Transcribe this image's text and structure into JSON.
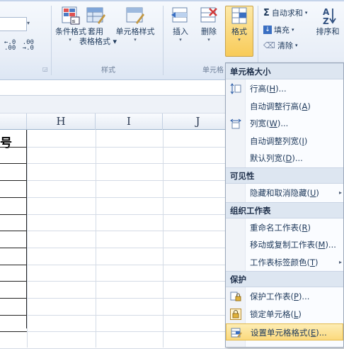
{
  "ribbon": {
    "styles_group": {
      "label": "样式",
      "conditional_format": "条件格式",
      "table_format_1": "套用",
      "table_format_2": "表格格式",
      "cell_styles": "单元格样式"
    },
    "cells_group": {
      "label": "单元格",
      "insert": "插入",
      "delete": "删除",
      "format": "格式"
    },
    "editing_group": {
      "autosum": "自动求和",
      "fill": "填充",
      "clear": "清除",
      "sort": "排序和"
    },
    "number_group": {
      "increase_decimal": "←.0\n.00",
      "decrease_decimal": ".00\n→.0"
    }
  },
  "sheet": {
    "columns": [
      "H",
      "I",
      "J"
    ],
    "visible_cell_text": "号"
  },
  "menu": {
    "sections": [
      {
        "header": "单元格大小",
        "items": [
          {
            "label": "行高(",
            "key": "H",
            "suffix": ")...",
            "icon": "row-height-icon"
          },
          {
            "label": "自动调整行高(",
            "key": "A",
            "suffix": ")",
            "icon": ""
          },
          {
            "label": "列宽(",
            "key": "W",
            "suffix": ")...",
            "icon": "column-width-icon"
          },
          {
            "label": "自动调整列宽(",
            "key": "I",
            "suffix": ")",
            "icon": ""
          },
          {
            "label": "默认列宽(",
            "key": "D",
            "suffix": ")...",
            "icon": ""
          }
        ]
      },
      {
        "header": "可见性",
        "items": [
          {
            "label": "隐藏和取消隐藏(",
            "key": "U",
            "suffix": ")",
            "icon": "",
            "submenu": true
          }
        ]
      },
      {
        "header": "组织工作表",
        "items": [
          {
            "label": "重命名工作表(",
            "key": "R",
            "suffix": ")",
            "icon": ""
          },
          {
            "label": "移动或复制工作表(",
            "key": "M",
            "suffix": ")...",
            "icon": ""
          },
          {
            "label": "工作表标签颜色(",
            "key": "T",
            "suffix": ")",
            "icon": "",
            "submenu": true
          }
        ]
      },
      {
        "header": "保护",
        "items": [
          {
            "label": "保护工作表(",
            "key": "P",
            "suffix": ")...",
            "icon": "protect-sheet-icon"
          },
          {
            "label": "锁定单元格(",
            "key": "L",
            "suffix": ")",
            "icon": "lock-icon"
          },
          {
            "label": "设置单元格格式(",
            "key": "E",
            "suffix": ")...",
            "icon": "format-cells-icon",
            "hover": true
          }
        ]
      }
    ]
  }
}
